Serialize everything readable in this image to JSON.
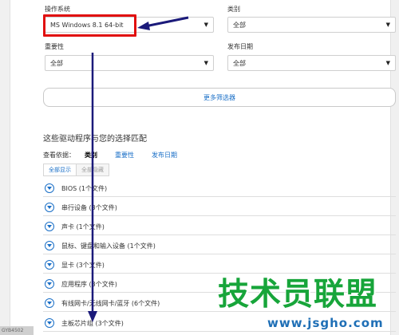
{
  "filters": {
    "os": {
      "label": "操作系统",
      "value": "MS Windows 8.1 64-bit"
    },
    "category": {
      "label": "类别",
      "value": "全部"
    },
    "importance": {
      "label": "重要性",
      "value": "全部"
    },
    "release_date": {
      "label": "发布日期",
      "value": "全部"
    },
    "more_filters": "更多筛选器"
  },
  "results": {
    "title": "这些驱动程序与您的选择匹配",
    "sort_by_label": "查看依据：",
    "sort_options": [
      "类别",
      "重要性",
      "发布日期"
    ],
    "toggle": {
      "expand_all": "全部显示",
      "collapse_all": "全部隐藏"
    },
    "categories": [
      "BIOS (1个文件)",
      "串行设备 (3个文件)",
      "声卡 (1个文件)",
      "鼠标、键盘和输入设备 (1个文件)",
      "显卡 (3个文件)",
      "应用程序 (3个文件)",
      "有线网卡/无线网卡/蓝牙 (6个文件)",
      "主板芯片组 (3个文件)"
    ]
  },
  "watermark": {
    "brand": "技术员联盟",
    "url": "www.jsgho.com"
  },
  "corner_code": "GYB4502",
  "colors": {
    "link": "#1a6fc7",
    "highlight": "#e10f0f",
    "arrow": "#1b1a7a",
    "watermark_green": "#17a53a",
    "watermark_blue": "#1f6fb6"
  }
}
